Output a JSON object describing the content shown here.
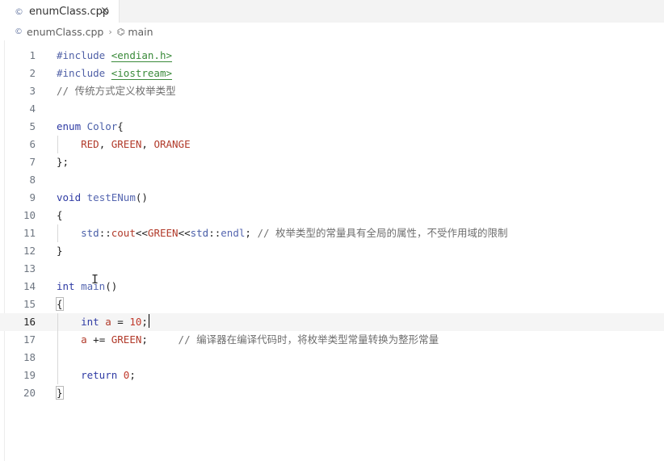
{
  "tab": {
    "label": "enumClass.cpp",
    "close": "×",
    "file_icon": "C++"
  },
  "breadcrumb": {
    "file": "enumClass.cpp",
    "separator": "›",
    "symbol": "main"
  },
  "code_lines": [
    {
      "n": "1",
      "html": "<span class=\"inc\">#include</span> <span class=\"str\">&lt;endian.h&gt;</span>"
    },
    {
      "n": "2",
      "html": "<span class=\"inc\">#include</span> <span class=\"str\">&lt;iostream&gt;</span>"
    },
    {
      "n": "3",
      "html": "<span class=\"cmt\">// 传统方式定义枚举类型</span>"
    },
    {
      "n": "4",
      "html": ""
    },
    {
      "n": "5",
      "html": "<span class=\"kw\">enum</span> <span class=\"ty\">Color</span>{"
    },
    {
      "n": "6",
      "html": "    <span class=\"enm\">RED</span>, <span class=\"enm\">GREEN</span>, <span class=\"enm\">ORANGE</span>"
    },
    {
      "n": "7",
      "html": "};"
    },
    {
      "n": "8",
      "html": ""
    },
    {
      "n": "9",
      "html": "<span class=\"kw\">void</span> <span class=\"fn\">testENum</span>()"
    },
    {
      "n": "10",
      "html": "{"
    },
    {
      "n": "11",
      "html": "    <span class=\"ns\">std</span>::<span class=\"var\">cout</span>&lt;&lt;<span class=\"enm\">GREEN</span>&lt;&lt;<span class=\"ns\">std</span>::<span class=\"fn\">endl</span>; <span class=\"cmt\">// 枚举类型的常量具有全局的属性，不受作用域的限制</span>"
    },
    {
      "n": "12",
      "html": "}"
    },
    {
      "n": "13",
      "html": ""
    },
    {
      "n": "14",
      "html": "<span class=\"kw\">int</span> <span class=\"fn\">main</span>()"
    },
    {
      "n": "15",
      "html": "<span class=\"brace-hl\">{</span>"
    },
    {
      "n": "16",
      "html": "    <span class=\"kw\">int</span> <span class=\"var\">a</span> = <span class=\"num\">10</span>;<span class=\"cursor\"></span>"
    },
    {
      "n": "17",
      "html": "    <span class=\"var\">a</span> += <span class=\"enm\">GREEN</span>;     <span class=\"cmt\">// 编译器在编译代码时，将枚举类型常量转换为整形常量</span>"
    },
    {
      "n": "18",
      "html": ""
    },
    {
      "n": "19",
      "html": "    <span class=\"kw\">return</span> <span class=\"num\">0</span>;"
    },
    {
      "n": "20",
      "html": "<span class=\"brace-hl\">}</span>"
    }
  ],
  "current_line": "16"
}
